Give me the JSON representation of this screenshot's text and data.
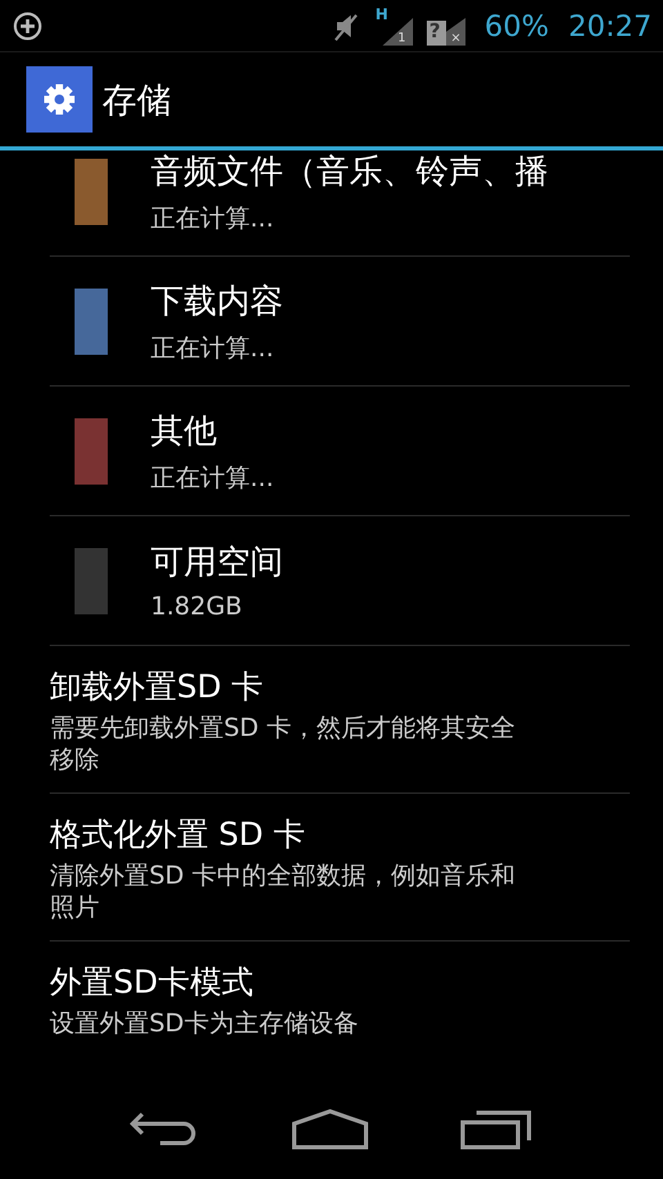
{
  "status_bar": {
    "network": "H",
    "sim_slot": "1",
    "sim2_mark": "?",
    "sim2_state": "×",
    "battery": "60%",
    "time": "20:27"
  },
  "action_bar": {
    "title": "存储"
  },
  "storage_items": [
    {
      "title": "音频文件（音乐、铃声、播",
      "summary": "正在计算...",
      "color": "#8a5a2e"
    },
    {
      "title": "下载内容",
      "summary": "正在计算...",
      "color": "#46689a"
    },
    {
      "title": "其他",
      "summary": "正在计算...",
      "color": "#7a3232"
    },
    {
      "title": "可用空间",
      "summary": "1.82GB",
      "color": "#333333"
    }
  ],
  "settings": [
    {
      "title": "卸载外置SD 卡",
      "summary": "需要先卸载外置SD 卡，然后才能将其安全移除"
    },
    {
      "title": "格式化外置 SD 卡",
      "summary": "清除外置SD 卡中的全部数据，例如音乐和照片"
    },
    {
      "title": "外置SD卡模式",
      "summary": "设置外置SD卡为主存储设备"
    }
  ]
}
